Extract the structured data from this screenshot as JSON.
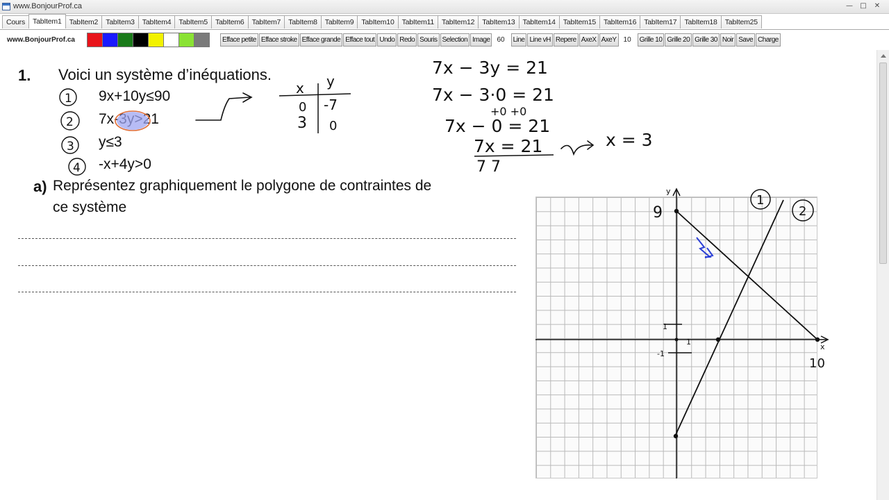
{
  "window": {
    "title": "www.BonjourProf.ca"
  },
  "tabs": [
    "Cours",
    "TabItem1",
    "TabItem2",
    "TabItem3",
    "TabItem4",
    "TabItem5",
    "TabItem6",
    "TabItem7",
    "TabItem8",
    "TabItem9",
    "TabItem10",
    "TabItem11",
    "TabItem12",
    "TabItem13",
    "TabItem14",
    "TabItem15",
    "TabItem16",
    "TabItem17",
    "TabItem18",
    "TabItem25"
  ],
  "active_tab": "TabItem1",
  "toolbar": {
    "site": "www.BonjourProf.ca",
    "colors": [
      "#e8141b",
      "#1a1aff",
      "#1a7a1a",
      "#000000",
      "#f2f200",
      "#ffffff",
      "#8ae234",
      "#7a7a7a"
    ],
    "buttons_a": [
      "Efface petite",
      "Efface stroke",
      "Efface grande",
      "Efface tout",
      "Undo",
      "Redo",
      "Souris",
      "Selection",
      "Image"
    ],
    "value_a": "60",
    "buttons_b": [
      "Line",
      "Line vH",
      "Repere",
      "AxeX",
      "AxeY"
    ],
    "value_b": "10",
    "buttons_c": [
      "Grille 10",
      "Grille 20",
      "Grille 30",
      "Noir",
      "Save",
      "Charge"
    ]
  },
  "question": {
    "number": "1.",
    "text": "Voici un système d’inéquations.",
    "inequalities": [
      "9x+10y≤90",
      "7x-3y>21",
      "y≤3",
      "-x+4y>0"
    ],
    "part_a_label": "a)",
    "part_a_line1": "Représentez graphiquement le polygone de contraintes de",
    "part_a_line2": "ce système"
  },
  "handwriting": {
    "circled_numbers": [
      "1",
      "2",
      "3",
      "4"
    ],
    "table_headers": [
      "x",
      "y"
    ],
    "table_rows": [
      [
        "0",
        "-7"
      ],
      [
        "3",
        "0"
      ]
    ],
    "work": [
      "7x − 3y = 21",
      "7x − 3·0 = 21",
      "+0     +0",
      "7x − 0 = 21",
      "7x = 21",
      "7      7",
      "x = 3"
    ],
    "graph_labels": {
      "y_axis": "y",
      "x_axis": "x",
      "y_intercept": "9",
      "x_intercept": "10",
      "line1": "1",
      "line2": "2",
      "unit_x": "1",
      "unit_y": "1",
      "neg_unit": "-1"
    }
  }
}
